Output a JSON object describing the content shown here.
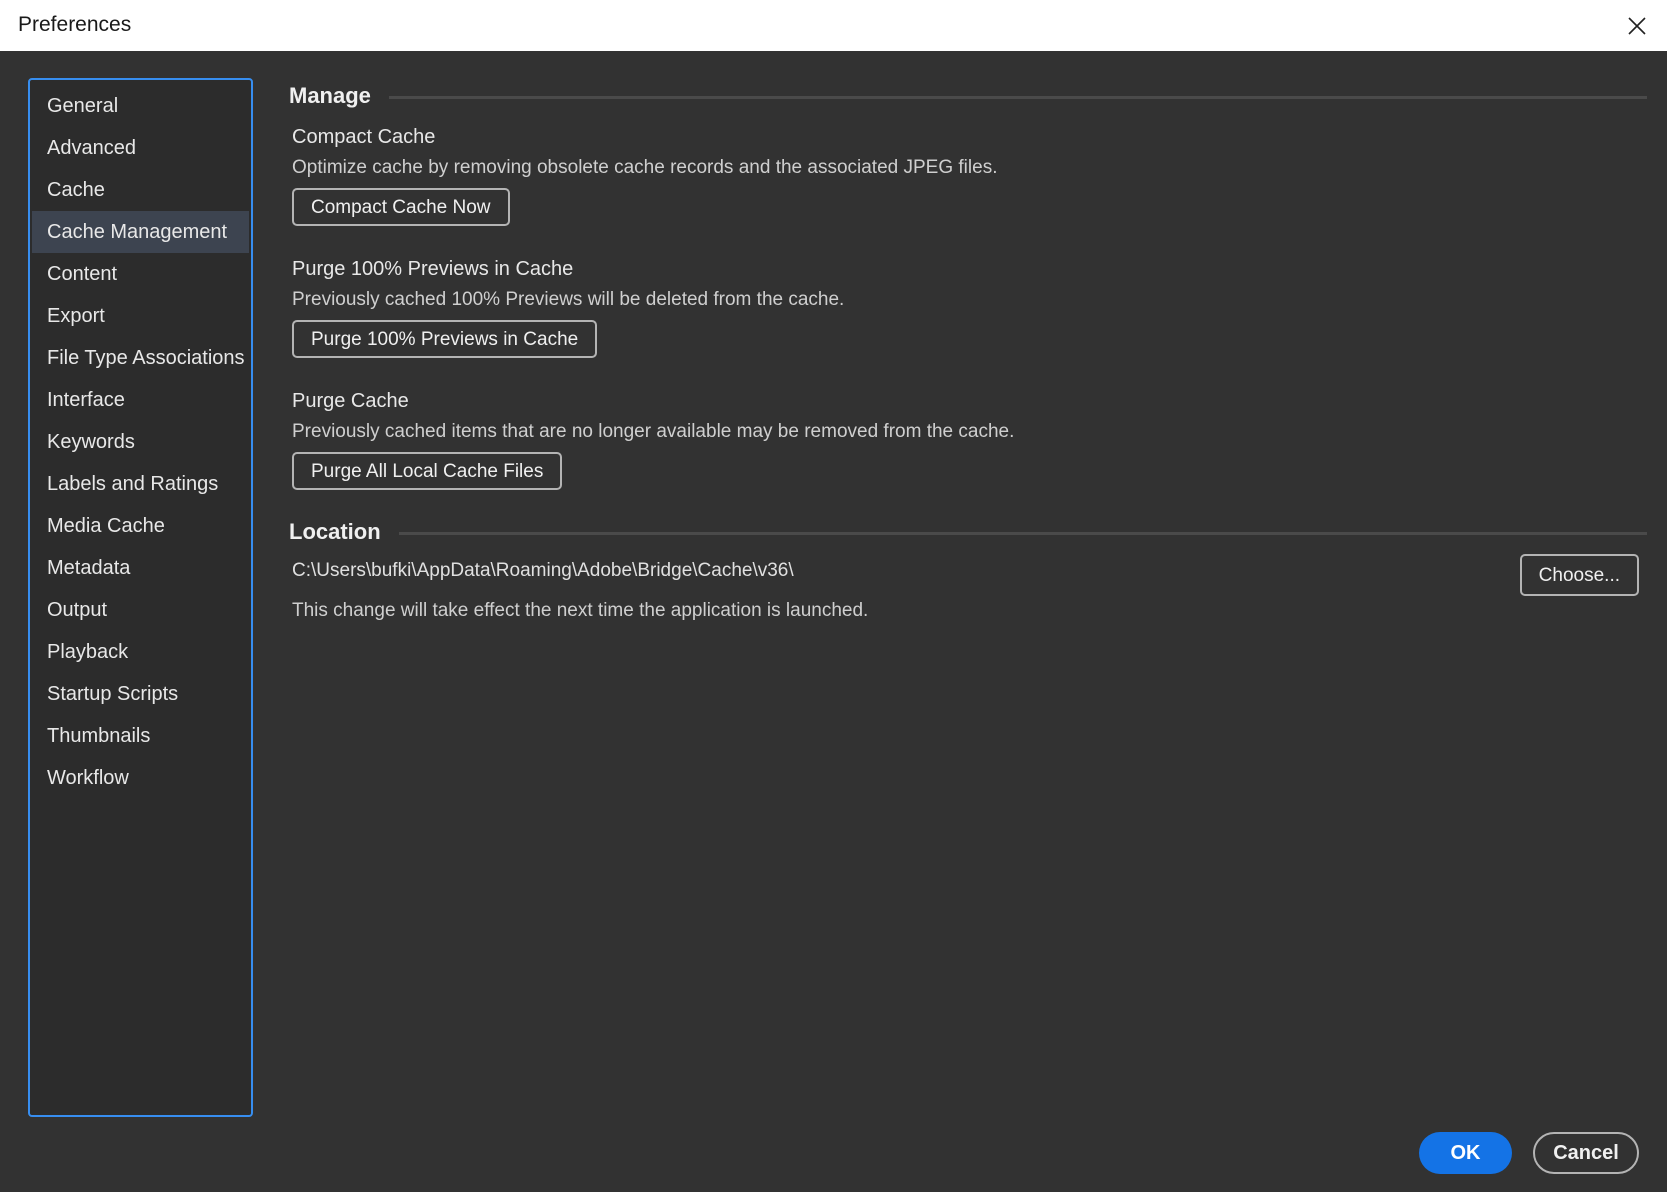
{
  "window": {
    "title": "Preferences",
    "close_icon": "close-icon"
  },
  "sidebar": {
    "selected_index": 3,
    "items": [
      {
        "label": "General"
      },
      {
        "label": "Advanced"
      },
      {
        "label": "Cache"
      },
      {
        "label": "Cache Management"
      },
      {
        "label": "Content"
      },
      {
        "label": "Export"
      },
      {
        "label": "File Type Associations"
      },
      {
        "label": "Interface"
      },
      {
        "label": "Keywords"
      },
      {
        "label": "Labels and Ratings"
      },
      {
        "label": "Media Cache"
      },
      {
        "label": "Metadata"
      },
      {
        "label": "Output"
      },
      {
        "label": "Playback"
      },
      {
        "label": "Startup Scripts"
      },
      {
        "label": "Thumbnails"
      },
      {
        "label": "Workflow"
      }
    ]
  },
  "manage": {
    "title": "Manage",
    "compact": {
      "title": "Compact Cache",
      "description": "Optimize cache by removing obsolete cache records and the associated JPEG files.",
      "button": "Compact Cache Now"
    },
    "purge_previews": {
      "title": "Purge 100% Previews in Cache",
      "description": "Previously cached 100% Previews will be deleted from the cache.",
      "button": "Purge 100% Previews in Cache"
    },
    "purge_cache": {
      "title": "Purge Cache",
      "description": "Previously cached items that are no longer available may be removed from the cache.",
      "button": "Purge All Local Cache Files"
    }
  },
  "location": {
    "title": "Location",
    "path": "C:\\Users\\bufki\\AppData\\Roaming\\Adobe\\Bridge\\Cache\\v36\\",
    "choose_button": "Choose...",
    "note": "This change will take effect the next time the application is launched."
  },
  "footer": {
    "ok": "OK",
    "cancel": "Cancel"
  },
  "colors": {
    "accent": "#1473e6",
    "focus_border": "#378ef0",
    "background": "#323232",
    "selected_item": "#3d4450"
  }
}
